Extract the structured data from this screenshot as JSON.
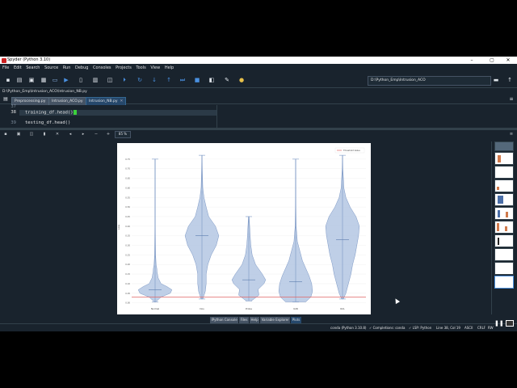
{
  "window": {
    "title": "Spyder (Python 3.10)",
    "controls": [
      "–",
      "▢",
      "✕"
    ]
  },
  "menu": [
    "File",
    "Edit",
    "Search",
    "Source",
    "Run",
    "Debug",
    "Consoles",
    "Projects",
    "Tools",
    "View",
    "Help"
  ],
  "toolbar": {
    "working_dir": "D:\\Python_Emp\\Intrusion_ACO"
  },
  "editor": {
    "file_path": "D:\\Python_Emp\\Intrusion_ACO\\Intrusion_NB.py",
    "tabs": [
      {
        "label": "Preprocessing.py",
        "active": false
      },
      {
        "label": "Intrusion_ACO.py",
        "active": false
      },
      {
        "label": "Intrusion_NB.py",
        "active": true
      }
    ],
    "lines": [
      {
        "num": "37",
        "code": ""
      },
      {
        "num": "38",
        "code": "training_df.head()"
      },
      {
        "num": "39",
        "code": "testing_df.head()"
      }
    ]
  },
  "plots": {
    "zoom": "85 %"
  },
  "chart_data": {
    "type": "violin",
    "title": "",
    "xlabel": "",
    "ylabel": "Loss",
    "categories": [
      "Normal",
      "Dos",
      "Probe",
      "U2R",
      "R2L"
    ],
    "yticks": [
      "0.00",
      "0.05",
      "0.10",
      "0.15",
      "0.20",
      "0.25",
      "0.30",
      "0.35",
      "0.40",
      "0.45",
      "0.50",
      "0.55",
      "0.60",
      "0.65",
      "0.70",
      "0.75"
    ],
    "ylim": [
      -0.01,
      0.8
    ],
    "threshold": 0.03,
    "legend": {
      "label": "Threshold Value",
      "position": "top-right"
    },
    "colors": {
      "violin": "#b4c7e3",
      "edge": "#7a96c4",
      "threshold": "#e06666"
    },
    "series": [
      {
        "category": "Normal",
        "min": 0.005,
        "max": 0.75,
        "median": 0.068,
        "profile": [
          [
            0.005,
            0.05
          ],
          [
            0.03,
            0.35
          ],
          [
            0.05,
            0.9
          ],
          [
            0.068,
            1.0
          ],
          [
            0.085,
            0.7
          ],
          [
            0.1,
            0.35
          ],
          [
            0.13,
            0.18
          ],
          [
            0.16,
            0.12
          ],
          [
            0.18,
            0.1
          ],
          [
            0.2,
            0.06
          ],
          [
            0.25,
            0.03
          ],
          [
            0.4,
            0.01
          ],
          [
            0.75,
            0.005
          ]
        ]
      },
      {
        "category": "Dos",
        "min": 0.02,
        "max": 0.77,
        "median": 0.35,
        "profile": [
          [
            0.02,
            0.05
          ],
          [
            0.06,
            0.2
          ],
          [
            0.1,
            0.25
          ],
          [
            0.15,
            0.25
          ],
          [
            0.2,
            0.35
          ],
          [
            0.25,
            0.55
          ],
          [
            0.3,
            0.85
          ],
          [
            0.35,
            1.0
          ],
          [
            0.4,
            0.8
          ],
          [
            0.45,
            0.4
          ],
          [
            0.5,
            0.25
          ],
          [
            0.55,
            0.12
          ],
          [
            0.6,
            0.05
          ],
          [
            0.7,
            0.02
          ],
          [
            0.77,
            0.005
          ]
        ]
      },
      {
        "category": "Probe",
        "min": 0.01,
        "max": 0.45,
        "median": 0.12,
        "profile": [
          [
            0.01,
            0.15
          ],
          [
            0.04,
            0.6
          ],
          [
            0.07,
            0.55
          ],
          [
            0.1,
            0.9
          ],
          [
            0.12,
            1.0
          ],
          [
            0.15,
            0.8
          ],
          [
            0.2,
            0.4
          ],
          [
            0.25,
            0.2
          ],
          [
            0.3,
            0.12
          ],
          [
            0.35,
            0.08
          ],
          [
            0.45,
            0.02
          ]
        ]
      },
      {
        "category": "U2R",
        "min": 0.005,
        "max": 0.75,
        "median": 0.11,
        "profile": [
          [
            0.005,
            0.6
          ],
          [
            0.03,
            0.9
          ],
          [
            0.06,
            1.0
          ],
          [
            0.1,
            0.95
          ],
          [
            0.14,
            0.8
          ],
          [
            0.18,
            0.6
          ],
          [
            0.22,
            0.4
          ],
          [
            0.27,
            0.25
          ],
          [
            0.32,
            0.1
          ],
          [
            0.4,
            0.03
          ],
          [
            0.5,
            0.015
          ],
          [
            0.75,
            0.005
          ]
        ]
      },
      {
        "category": "R2L",
        "min": 0.02,
        "max": 0.77,
        "median": 0.33,
        "profile": [
          [
            0.02,
            0.05
          ],
          [
            0.05,
            0.2
          ],
          [
            0.1,
            0.35
          ],
          [
            0.15,
            0.5
          ],
          [
            0.2,
            0.6
          ],
          [
            0.25,
            0.75
          ],
          [
            0.3,
            0.85
          ],
          [
            0.35,
            0.95
          ],
          [
            0.4,
            1.0
          ],
          [
            0.45,
            0.8
          ],
          [
            0.5,
            0.45
          ],
          [
            0.55,
            0.2
          ],
          [
            0.6,
            0.08
          ],
          [
            0.7,
            0.02
          ],
          [
            0.77,
            0.005
          ]
        ]
      }
    ]
  },
  "pane_tabs": [
    {
      "label": "IPython Console",
      "active": false
    },
    {
      "label": "Files",
      "active": false
    },
    {
      "label": "Help",
      "active": false
    },
    {
      "label": "Variable Explorer",
      "active": false
    },
    {
      "label": "Plots",
      "active": true
    },
    {
      "label": "History",
      "active": false
    }
  ],
  "statusbar": {
    "env": "conda (Python 3.10.8)",
    "completions": "✓ Completions: conda",
    "lsp": "✓ LSP: Python",
    "position": "Line 38, Col 19",
    "encoding": "ASCII",
    "eol": "CRLF",
    "perm": "RW"
  }
}
